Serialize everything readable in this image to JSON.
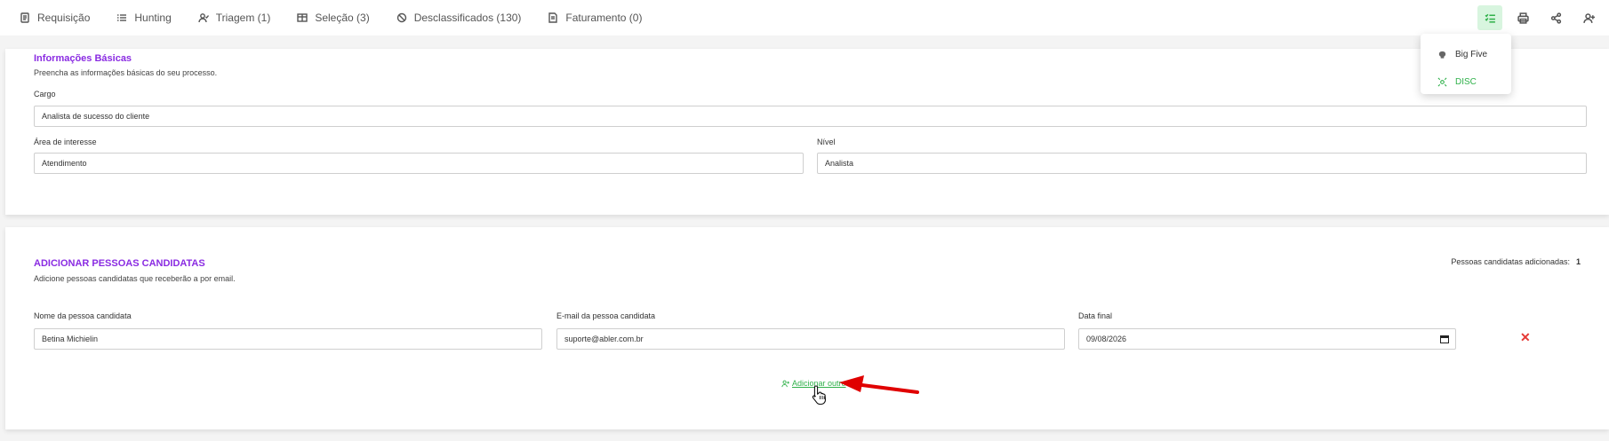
{
  "nav": {
    "tabs": [
      {
        "label": "Requisição",
        "icon": "document-icon"
      },
      {
        "label": "Hunting",
        "icon": "list-icon"
      },
      {
        "label": "Triagem (1)",
        "icon": "user-check-icon"
      },
      {
        "label": "Seleção (3)",
        "icon": "table-icon"
      },
      {
        "label": "Desclassificados (130)",
        "icon": "ban-icon"
      },
      {
        "label": "Faturamento (0)",
        "icon": "invoice-icon"
      }
    ],
    "actions": [
      "checklist-icon",
      "print-icon",
      "share-icon",
      "add-user-icon"
    ]
  },
  "dropdown": {
    "items": [
      {
        "label": "Big Five",
        "icon": "brain-icon"
      },
      {
        "label": "DISC",
        "icon": "target-icon"
      }
    ]
  },
  "basic_info": {
    "title": "Informações Básicas",
    "subtitle": "Preencha as informações básicas do seu processo.",
    "cargo_label": "Cargo",
    "cargo_value": "Analista de sucesso do cliente",
    "area_label": "Área de interesse",
    "area_value": "Atendimento",
    "nivel_label": "Nível",
    "nivel_value": "Analista"
  },
  "candidates": {
    "title": "ADICIONAR PESSOAS CANDIDATAS",
    "subtitle": "Adicione pessoas candidatas que receberão a por email.",
    "count_label": "Pessoas candidatas adicionadas:",
    "count_value": "1",
    "name_label": "Nome da pessoa candidata",
    "name_value": "Betina Michielin",
    "email_label": "E-mail da pessoa candidata",
    "email_value": "suporte@abler.com.br",
    "date_label": "Data final",
    "date_value": "09/08/2026",
    "remove_symbol": "✕",
    "add_label": "Adicionar outro"
  },
  "colors": {
    "accent_purple": "#8a2be2",
    "accent_green": "#2fb14a",
    "danger_red": "#e53935",
    "annotation_arrow": "#e00000"
  }
}
